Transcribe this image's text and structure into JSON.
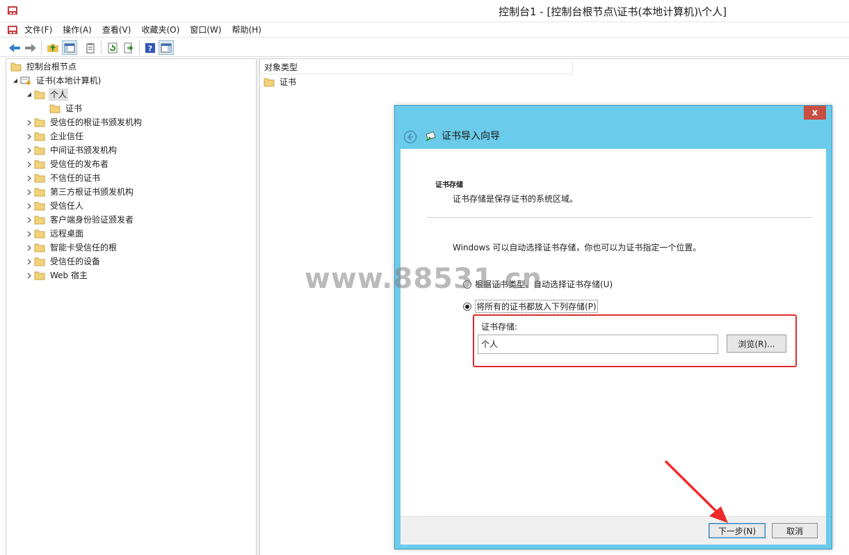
{
  "window": {
    "title": "控制台1 - [控制台根节点\\证书(本地计算机)\\个人]"
  },
  "menu": {
    "items": [
      "文件(F)",
      "操作(A)",
      "查看(V)",
      "收藏夹(O)",
      "窗口(W)",
      "帮助(H)"
    ]
  },
  "toolbar": {
    "buttons": [
      "back-icon",
      "forward-icon",
      "up-folder-icon",
      "show-tree-icon",
      "properties-icon",
      "refresh-icon",
      "export-list-icon",
      "help-icon",
      "action-pane-icon"
    ]
  },
  "tree": {
    "root": "控制台根节点",
    "certs_node": "证书(本地计算机)",
    "personal": "个人",
    "personal_child": "证书",
    "stores": [
      "受信任的根证书颁发机构",
      "企业信任",
      "中间证书颁发机构",
      "受信任的发布者",
      "不信任的证书",
      "第三方根证书颁发机构",
      "受信任人",
      "客户端身份验证颁发者",
      "远程桌面",
      "智能卡受信任的根",
      "受信任的设备",
      "Web 宿主"
    ]
  },
  "list": {
    "column_header": "对象类型",
    "rows": [
      "证书"
    ]
  },
  "dialog": {
    "close_label": "x",
    "title": "证书导入向导",
    "section_heading": "证书存储",
    "section_desc": "证书存储是保存证书的系统区域。",
    "intro": "Windows 可以自动选择证书存储，你也可以为证书指定一个位置。",
    "radio_auto": "根据证书类型，自动选择证书存储(U)",
    "radio_manual": "将所有的证书都放入下列存储(P)",
    "store_label": "证书存储:",
    "store_value": "个人",
    "browse_label": "浏览(R)...",
    "next_label": "下一步(N)",
    "cancel_label": "取消",
    "highlight_color": "#e02b2b",
    "accent_color": "#6bcbea"
  },
  "watermark": {
    "text": "www.88531.cn"
  }
}
